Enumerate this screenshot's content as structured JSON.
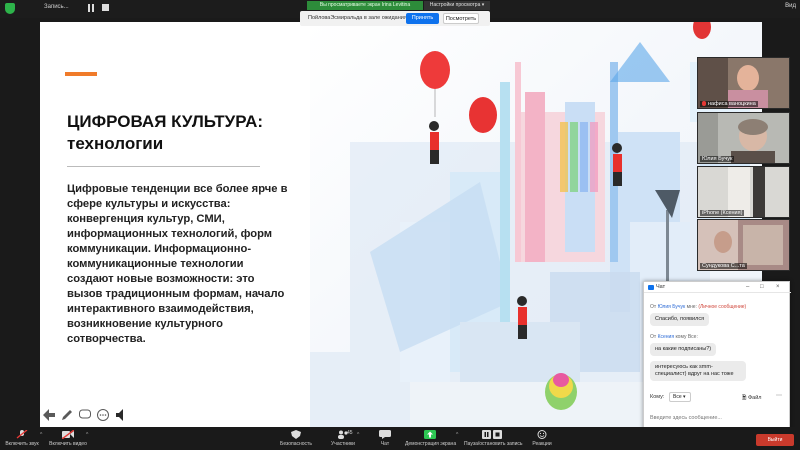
{
  "topbar": {
    "recording_label": "Запись...",
    "share_banner": "Вы просматриваете экран Irina Levitina",
    "view_options": "Настройки просмотра ▾",
    "view_button": "Вид"
  },
  "waiting_room": {
    "text": "ПойловаЭсмиральда в зале ожидания",
    "admit_label": "Принять",
    "see_label": "Посмотреть"
  },
  "slide": {
    "title": "ЦИФРОВАЯ КУЛЬТУРА: технологии",
    "body": "Цифровые тенденции все более ярче в сфере культуры и искусства: конвергенция культур, СМИ, информационных технологий, форм коммуникации. Информационно-коммуникационные технологии создают новые возможности: это вызов традиционным формам, начало интерактивного взаимодействия, возникновение культурного сотворчества.",
    "accent_color": "#f07b2a"
  },
  "participants": [
    {
      "name": "нафиса ваноцкина",
      "muted": true
    },
    {
      "name": "Юлия Бучук",
      "muted": false
    },
    {
      "name": "iPhone (Ксения)",
      "muted": false
    },
    {
      "name": "Сундукова С...та",
      "muted": false
    }
  ],
  "chat": {
    "title": "Чат",
    "messages": [
      {
        "from_prefix": "От",
        "sender": "Юлия Бучук",
        "recipient": "мне:",
        "private_note": "(Личное сообщение)",
        "texts": [
          "Спасибо, появился"
        ]
      },
      {
        "from_prefix": "От",
        "sender": "Ксения",
        "recipient": "кому Все:",
        "private_note": "",
        "texts": [
          "на какие подписаны?)",
          "интересуюсь как smm-специалист) вдруг на нас тоже"
        ]
      }
    ],
    "to_label": "Кому:",
    "to_value": "Все",
    "file_label": "Файл",
    "input_placeholder": "Введите здесь сообщение..."
  },
  "toolbar": {
    "items": [
      {
        "label": "Включить звук",
        "icon": "mic-off-icon"
      },
      {
        "label": "Включить видео",
        "icon": "video-off-icon"
      },
      {
        "label": "Безопасность",
        "icon": "shield-icon"
      },
      {
        "label": "Участники",
        "icon": "participants-icon",
        "count": "45"
      },
      {
        "label": "Чат",
        "icon": "chat-icon"
      },
      {
        "label": "Демонстрация экрана",
        "icon": "share-screen-icon"
      },
      {
        "label": "Пауза/остановить запись",
        "icon": "recording-icon"
      },
      {
        "label": "Реакции",
        "icon": "smiley-icon"
      }
    ],
    "end_label": "Выйти"
  },
  "colors": {
    "zoom_blue": "#0e72ed",
    "share_green": "#2d8c3a",
    "share_icon_green": "#2dc653",
    "end_red": "#c93a2c"
  }
}
